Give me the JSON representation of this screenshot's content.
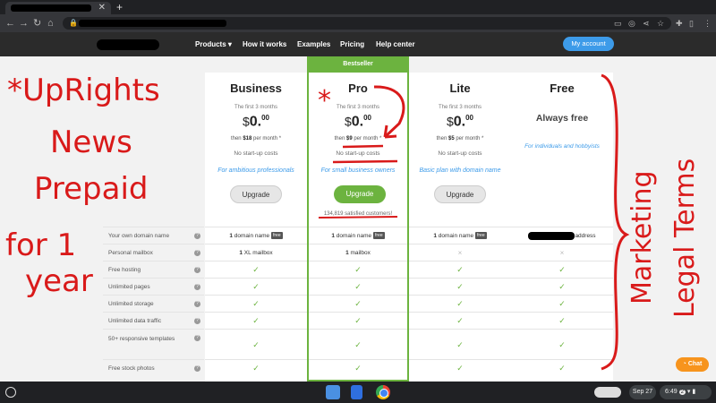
{
  "nav": {
    "products": "Products ▾",
    "how_it_works": "How it works",
    "examples": "Examples",
    "pricing": "Pricing",
    "help_center": "Help center",
    "my_account": "My account"
  },
  "pricing": {
    "bestseller": "Bestseller",
    "plans": [
      {
        "name": "Business",
        "intro": "The first 3 months",
        "currency": "$",
        "price_main": "0.",
        "price_cents": "00",
        "then_pre": "then ",
        "then_price": "$18",
        "then_post": " per month *",
        "no_startup": "No start-up costs",
        "tagline": "For ambitious professionals",
        "button": "Upgrade"
      },
      {
        "name": "Pro",
        "intro": "The first 3 months",
        "currency": "$",
        "price_main": "0.",
        "price_cents": "00",
        "then_pre": "then ",
        "then_price": "$9",
        "then_post": " per month *",
        "no_startup": "No start-up costs",
        "tagline": "For small business owners",
        "button": "Upgrade",
        "satisfied": "134,819 satisfied customers!"
      },
      {
        "name": "Lite",
        "intro": "The first 3 months",
        "currency": "$",
        "price_main": "0.",
        "price_cents": "00",
        "then_pre": "then ",
        "then_price": "$5",
        "then_post": " per month *",
        "no_startup": "No start-up costs",
        "tagline": "Basic plan with domain name",
        "button": "Upgrade"
      },
      {
        "name": "Free",
        "always_free": "Always free",
        "tagline": "For individuals and hobbyists"
      }
    ],
    "features": [
      "Your own domain name",
      "Personal mailbox",
      "Free hosting",
      "Unlimited pages",
      "Unlimited storage",
      "Unlimited data traffic",
      "50+ responsive templates",
      "Free stock photos"
    ],
    "cells": {
      "business": [
        "1",
        "1"
      ],
      "pro": [
        "1",
        "1"
      ],
      "lite": [
        "1"
      ],
      "domain_text": " domain name",
      "mailbox_xl_text": " XL mailbox",
      "mailbox_text": " mailbox",
      "free_badge": "free",
      "free_address": "address"
    },
    "check": "✓",
    "cross": "×"
  },
  "chat": "Chat",
  "annotations": {
    "left_lines": [
      "*UpRights",
      "News",
      "Prepaid",
      "for 1",
      "year"
    ],
    "right_lines": [
      "Marketing",
      "Legal Terms"
    ],
    "star": "*"
  },
  "shelf": {
    "date": "Sep 27",
    "time": "6:49",
    "notif_count": "2"
  }
}
